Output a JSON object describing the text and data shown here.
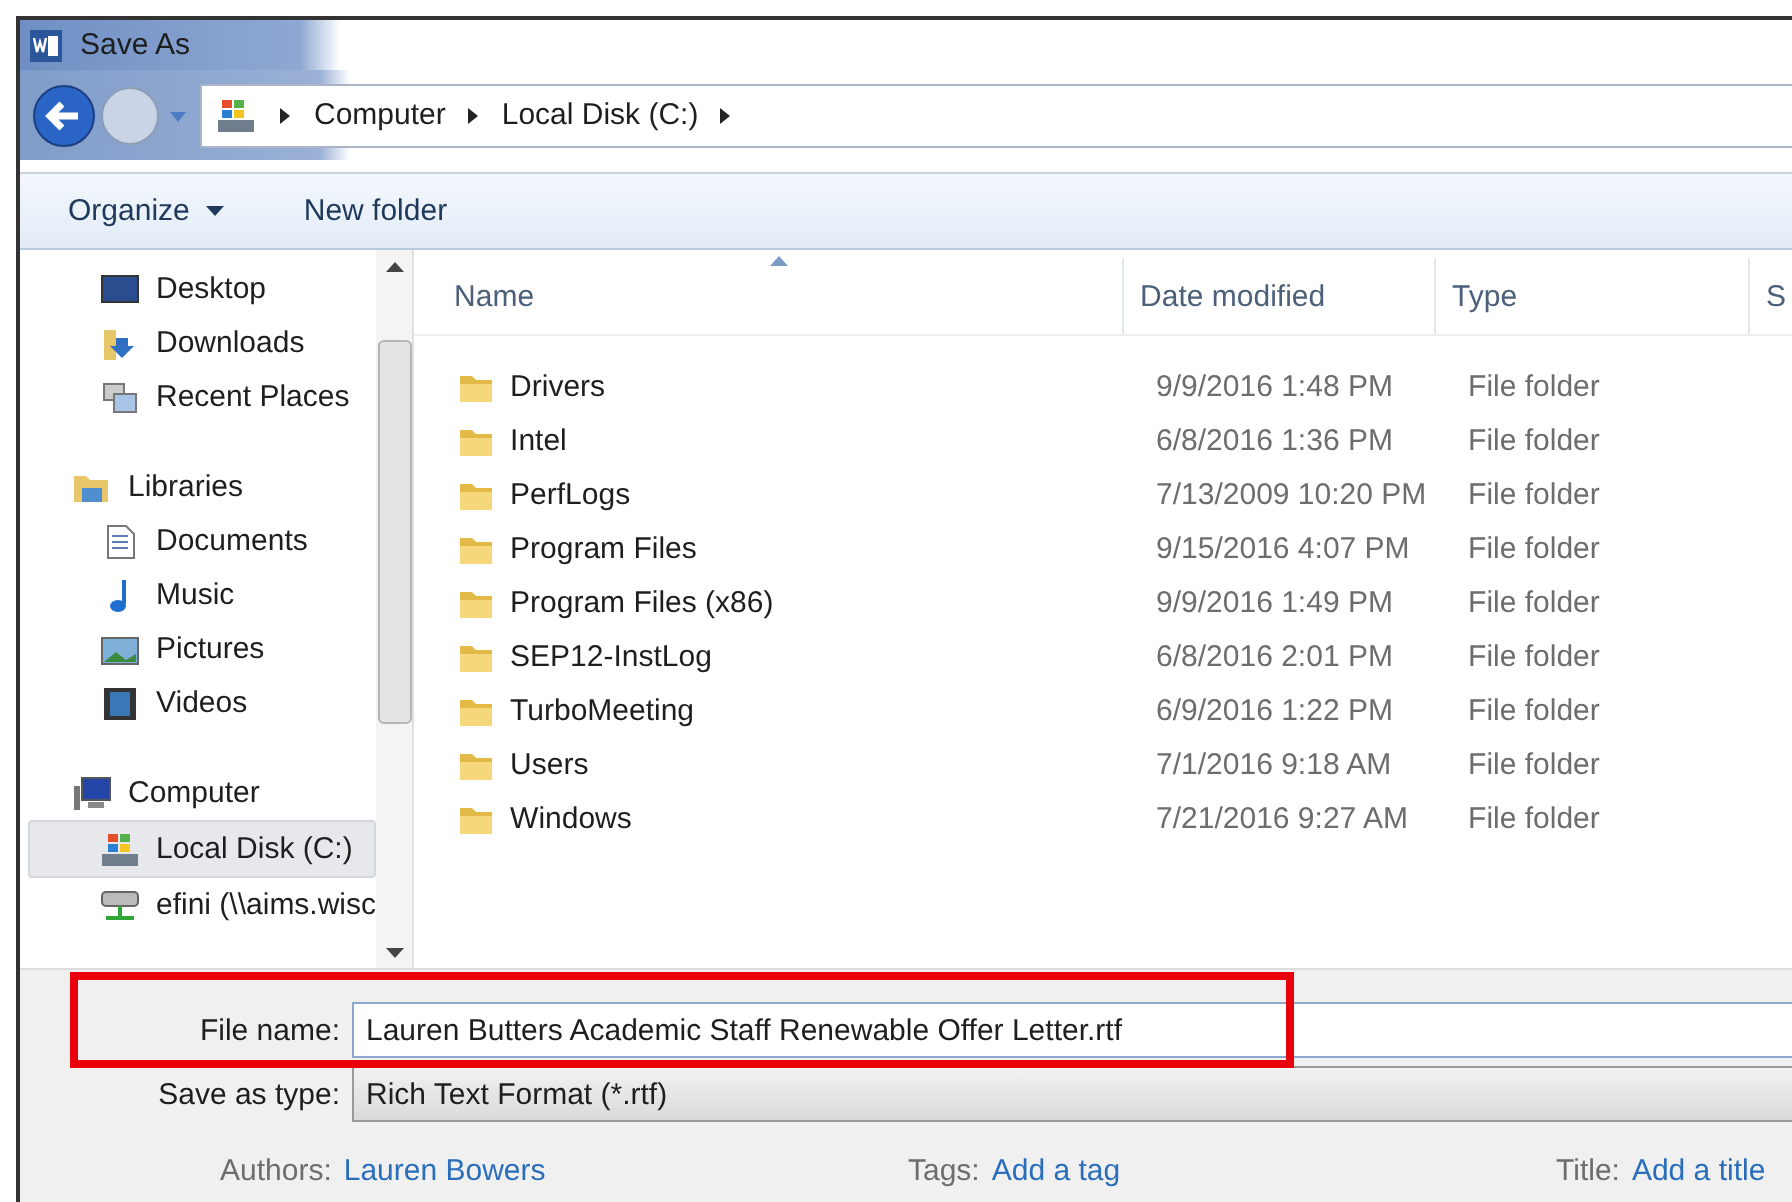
{
  "window": {
    "title": "Save As"
  },
  "address": {
    "path": [
      "Computer",
      "Local Disk (C:)"
    ]
  },
  "toolbar": [
    {
      "label": "Organize",
      "dropdown": true
    },
    {
      "label": "New folder",
      "dropdown": false
    }
  ],
  "sidebar": {
    "groups": [
      {
        "items": [
          {
            "label": "Desktop",
            "kind": "desktop",
            "selected": false
          },
          {
            "label": "Downloads",
            "kind": "downloads",
            "selected": false
          },
          {
            "label": "Recent Places",
            "kind": "recent",
            "selected": false
          }
        ]
      },
      {
        "label": "Libraries",
        "kind": "libraries",
        "items": [
          {
            "label": "Documents",
            "kind": "documents",
            "selected": false
          },
          {
            "label": "Music",
            "kind": "music",
            "selected": false
          },
          {
            "label": "Pictures",
            "kind": "pictures",
            "selected": false
          },
          {
            "label": "Videos",
            "kind": "videos",
            "selected": false
          }
        ]
      },
      {
        "label": "Computer",
        "kind": "computer",
        "items": [
          {
            "label": "Local Disk (C:)",
            "kind": "disk",
            "selected": true
          },
          {
            "label": "efini (\\\\aims.wisc",
            "kind": "network",
            "selected": false
          }
        ]
      }
    ]
  },
  "table": {
    "columns": [
      "Name",
      "Date modified",
      "Type",
      "S"
    ],
    "rows": [
      {
        "name": "Drivers",
        "date": "9/9/2016 1:48 PM",
        "type": "File folder"
      },
      {
        "name": "Intel",
        "date": "6/8/2016 1:36 PM",
        "type": "File folder"
      },
      {
        "name": "PerfLogs",
        "date": "7/13/2009 10:20 PM",
        "type": "File folder"
      },
      {
        "name": "Program Files",
        "date": "9/15/2016 4:07 PM",
        "type": "File folder"
      },
      {
        "name": "Program Files (x86)",
        "date": "9/9/2016 1:49 PM",
        "type": "File folder"
      },
      {
        "name": "SEP12-InstLog",
        "date": "6/8/2016 2:01 PM",
        "type": "File folder"
      },
      {
        "name": "TurboMeeting",
        "date": "6/9/2016 1:22 PM",
        "type": "File folder"
      },
      {
        "name": "Users",
        "date": "7/1/2016 9:18 AM",
        "type": "File folder"
      },
      {
        "name": "Windows",
        "date": "7/21/2016 9:27 AM",
        "type": "File folder"
      }
    ]
  },
  "form": {
    "file_name": {
      "label": "File name:",
      "value": "Lauren Butters Academic Staff Renewable Offer Letter.rtf"
    },
    "save_as_type": {
      "label": "Save as type:",
      "value": "Rich Text Format (*.rtf)"
    },
    "meta": [
      {
        "label": "Authors:",
        "value": "Lauren Bowers"
      },
      {
        "label": "Tags:",
        "value": "Add a tag"
      },
      {
        "label": "Title:",
        "value": "Add a title"
      }
    ]
  }
}
